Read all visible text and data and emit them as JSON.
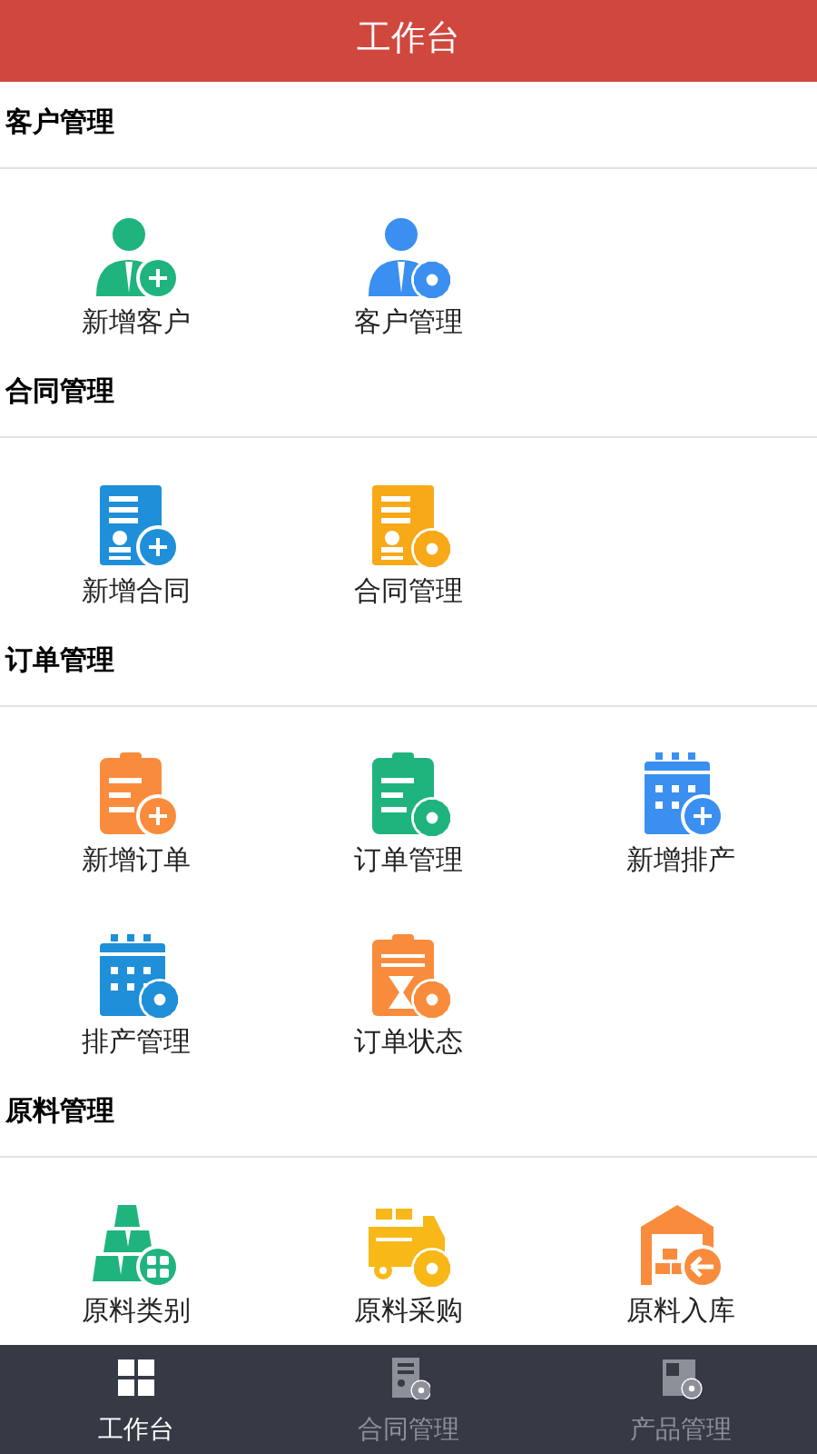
{
  "header": {
    "title": "工作台"
  },
  "sections": [
    {
      "title": "客户管理",
      "items": [
        {
          "label": "新增客户",
          "kind": "personadd",
          "color": "#1fb47d"
        },
        {
          "label": "客户管理",
          "kind": "personmanage",
          "color": "#3a8ff0"
        }
      ]
    },
    {
      "title": "合同管理",
      "items": [
        {
          "label": "新增合同",
          "kind": "docadd",
          "color": "#1e8fd8"
        },
        {
          "label": "合同管理",
          "kind": "docmanage",
          "color": "#f7a918"
        }
      ]
    },
    {
      "title": "订单管理",
      "items": [
        {
          "label": "新增订单",
          "kind": "orderadd",
          "color": "#f98c3c"
        },
        {
          "label": "订单管理",
          "kind": "ordermanage",
          "color": "#1fb47d"
        },
        {
          "label": "新增排产",
          "kind": "scheduleadd",
          "color": "#3a8ff0"
        },
        {
          "label": "排产管理",
          "kind": "schedulemanage",
          "color": "#1e8fd8"
        },
        {
          "label": "订单状态",
          "kind": "orderstatus",
          "color": "#f98c3c"
        }
      ]
    },
    {
      "title": "原料管理",
      "items": [
        {
          "label": "原料类别",
          "kind": "materialtype",
          "color": "#1fb47d"
        },
        {
          "label": "原料采购",
          "kind": "purchase",
          "color": "#f7b818"
        },
        {
          "label": "原料入库",
          "kind": "stockin",
          "color": "#f98c3c"
        }
      ]
    }
  ],
  "tabs": [
    {
      "label": "工作台",
      "kind": "workbench",
      "selected": true
    },
    {
      "label": "合同管理",
      "kind": "contract",
      "selected": false
    },
    {
      "label": "产品管理",
      "kind": "product",
      "selected": false
    }
  ]
}
